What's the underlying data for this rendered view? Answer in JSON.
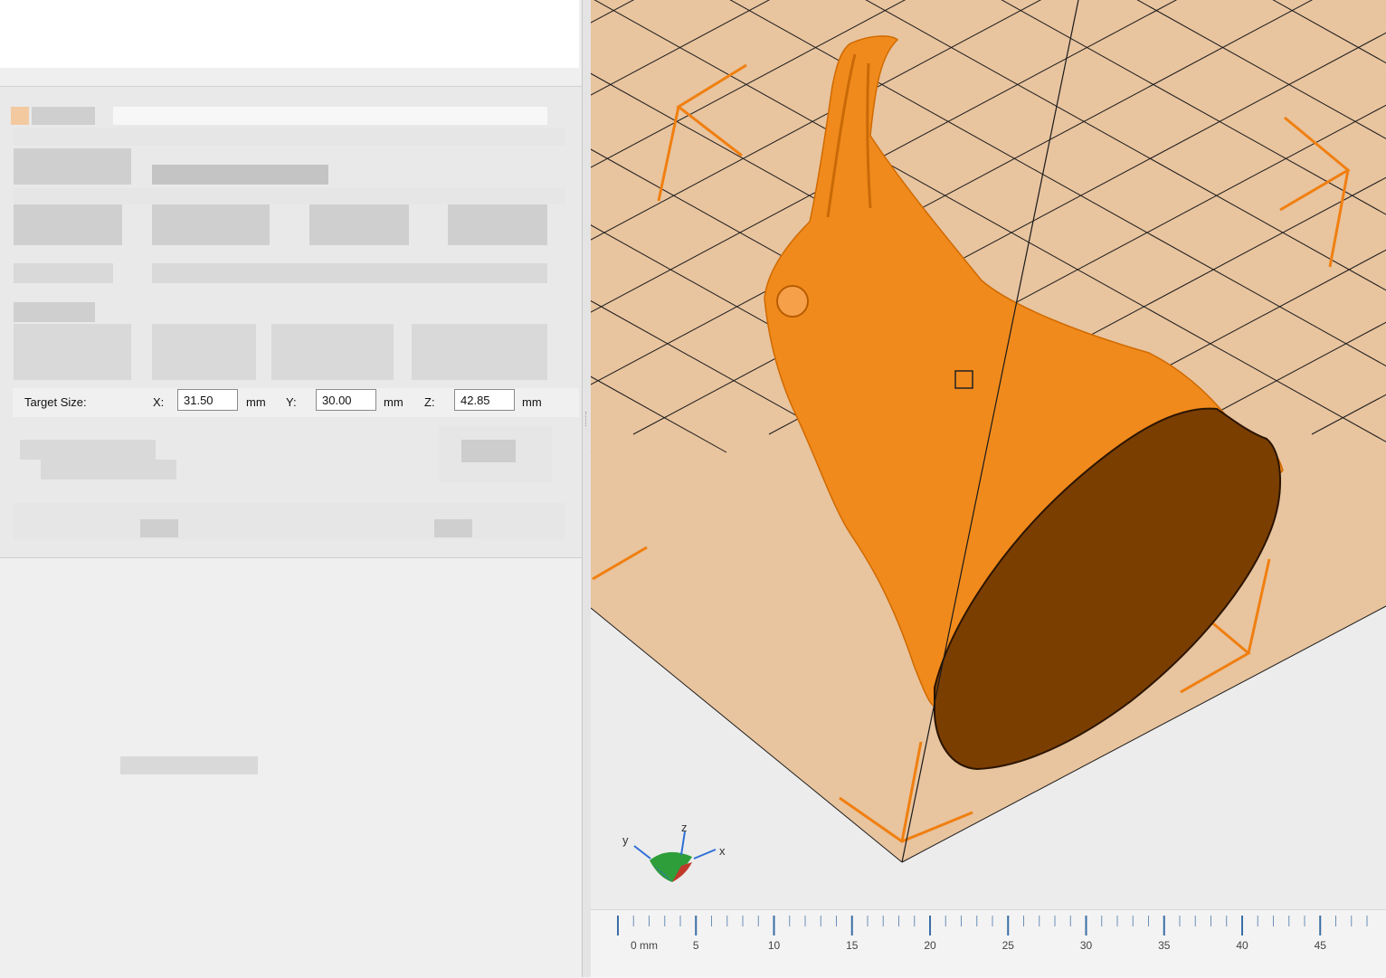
{
  "target_size": {
    "label": "Target Size:",
    "x": {
      "axis_label": "X:",
      "value": "31.50",
      "unit": "mm"
    },
    "y": {
      "axis_label": "Y:",
      "value": "30.00",
      "unit": "mm"
    },
    "z": {
      "axis_label": "Z:",
      "value": "42.85",
      "unit": "mm"
    }
  },
  "axis_gizmo": {
    "x": "x",
    "y": "y",
    "z": "z"
  },
  "ruler": {
    "first_label": "0 mm",
    "labels": [
      "5",
      "10",
      "15",
      "20",
      "25",
      "30",
      "35",
      "40",
      "45"
    ]
  },
  "colors": {
    "model": "#f08a1c",
    "model_cut_face": "#7a3e00",
    "build_plate": "#e8c49f",
    "plate_corner_marks": "#f07f10",
    "grid_lines": "#1a1a1a",
    "gizmo_x": "#c0392b",
    "gizmo_y": "#2f6fd6",
    "gizmo_z": "#2e9e3a"
  }
}
